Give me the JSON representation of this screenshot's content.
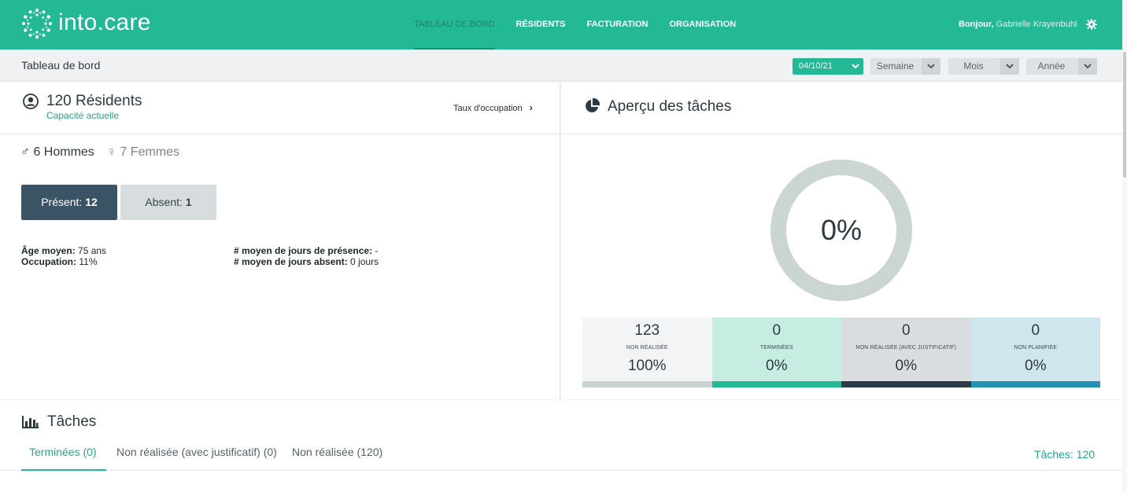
{
  "app": {
    "logo_text": "into.care"
  },
  "nav": {
    "items": [
      {
        "label": "TABLEAU DE BORD"
      },
      {
        "label": "RÉSIDENTS"
      },
      {
        "label": "FACTURATION"
      },
      {
        "label": "ORGANISATION"
      }
    ],
    "greeting": "Bonjour,",
    "user_name": "Gabrielle Krayenbuhl"
  },
  "subheader": {
    "title": "Tableau de bord",
    "date": "04/10/21",
    "week": "Semaine",
    "month": "Mois",
    "year": "Année"
  },
  "residents": {
    "count_label": "120 Résidents",
    "capacity_label": "Capacité actuelle",
    "taux_link": "Taux d'occupation",
    "male_label": "6 Hommes",
    "female_label": "7 Femmes",
    "present_label": "Présent:",
    "present_count": "12",
    "absent_label": "Absent:",
    "absent_count": "1",
    "age_label": "Âge moyen:",
    "age_value": "75 ans",
    "occupation_label": "Occupation:",
    "occupation_value": "11%",
    "presence_days_label": "# moyen de jours de présence:",
    "presence_days_value": "-",
    "absent_days_label": "# moyen de jours absent:",
    "absent_days_value": "0 jours"
  },
  "overview": {
    "title": "Aperçu des tâches",
    "percent": "0%",
    "cards": [
      {
        "num": "123",
        "label": "NON RÉALISÉE",
        "pct": "100%",
        "bg": "#f2f4f6",
        "bar": "#c9d3d1"
      },
      {
        "num": "0",
        "label": "TERMINÉES",
        "pct": "0%",
        "bg": "#c7ece2",
        "bar": "#23b896"
      },
      {
        "num": "0",
        "label": "NON RÉALISÉE (AVEC JUSTIFICATIF)",
        "pct": "0%",
        "bg": "#d9dde0",
        "bar": "#2d3a48"
      },
      {
        "num": "0",
        "label": "NON PLANIFIÉE",
        "pct": "0%",
        "bg": "#cfe6ee",
        "bar": "#2692b1"
      }
    ]
  },
  "tasks": {
    "title": "Tâches",
    "tabs": [
      {
        "label": "Terminées (0)"
      },
      {
        "label": "Non réalisée (avec justificatif) (0)"
      },
      {
        "label": "Non réalisée (120)"
      }
    ],
    "count": "Tâches: 120"
  },
  "colors": {
    "brand": "#23b896",
    "dark": "#3a5466"
  }
}
